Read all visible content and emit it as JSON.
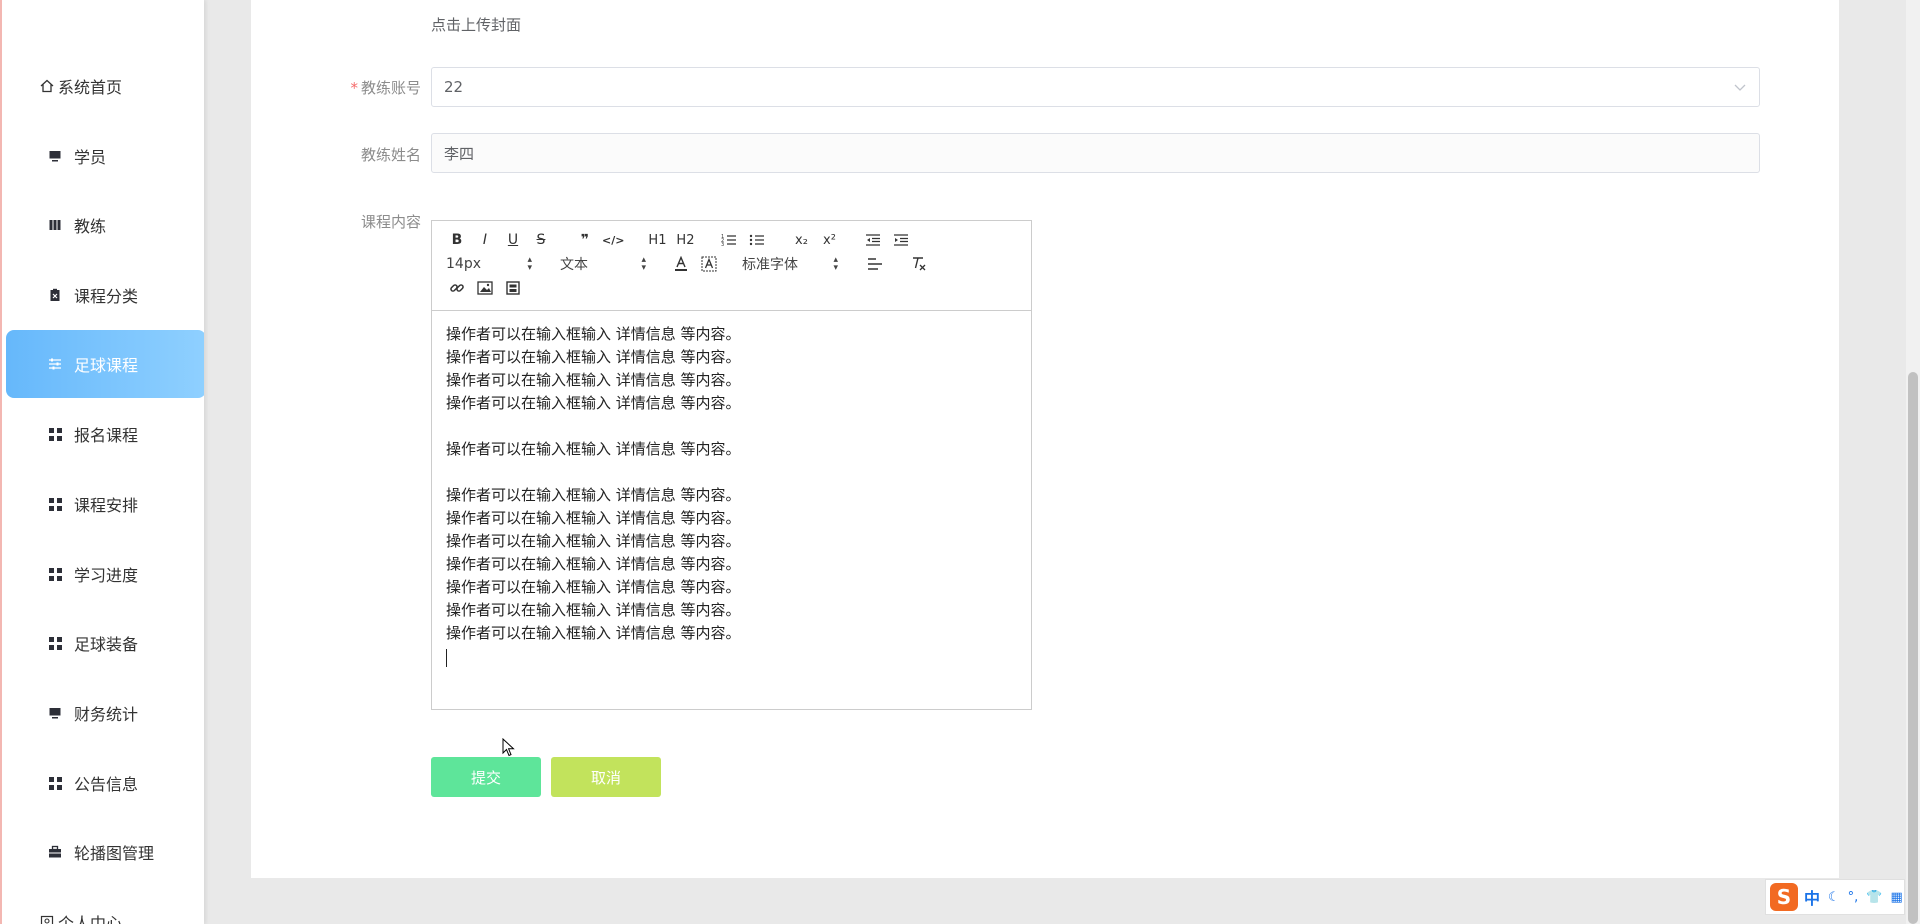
{
  "sidebar": {
    "items": [
      {
        "label": "系统首页",
        "icon": "home-icon"
      },
      {
        "label": "学员",
        "icon": "monitor-icon"
      },
      {
        "label": "教练",
        "icon": "book-icon"
      },
      {
        "label": "课程分类",
        "icon": "clipboard-icon"
      },
      {
        "label": "足球课程",
        "icon": "sliders-icon",
        "active": true
      },
      {
        "label": "报名课程",
        "icon": "grid-icon"
      },
      {
        "label": "课程安排",
        "icon": "grid-icon"
      },
      {
        "label": "学习进度",
        "icon": "grid-icon"
      },
      {
        "label": "足球装备",
        "icon": "grid-icon"
      },
      {
        "label": "财务统计",
        "icon": "monitor-icon"
      },
      {
        "label": "公告信息",
        "icon": "grid-icon"
      },
      {
        "label": "轮播图管理",
        "icon": "briefcase-icon"
      },
      {
        "label": "个人中心",
        "icon": "person-icon"
      }
    ]
  },
  "form": {
    "cover_upload_text": "点击上传封面",
    "coach_account_label": "教练账号",
    "coach_account_value": "22",
    "coach_name_label": "教练姓名",
    "coach_name_value": "李四",
    "course_content_label": "课程内容"
  },
  "editor": {
    "toolbar": {
      "bold": "B",
      "italic": "I",
      "underline": "U",
      "strike": "S",
      "quote": "❞",
      "code": "</>",
      "h1": "H1",
      "h2": "H2",
      "subscript": "x₂",
      "superscript": "x²",
      "font_size": "14px",
      "header_select": "文本",
      "font_family": "标准字体"
    },
    "lines": {
      "l1": "操作者可以在输入框输入  详情信息  等内容。",
      "l2": "操作者可以在输入框输入  详情信息  等内容。",
      "l3": "操作者可以在输入框输入  详情信息  等内容。",
      "l4": "操作者可以在输入框输入  详情信息  等内容。",
      "l5": "操作者可以在输入框输入  详情信息  等内容。",
      "l6": "操作者可以在输入框输入  详情信息  等内容。",
      "l7": "操作者可以在输入框输入  详情信息  等内容。",
      "l8": "操作者可以在输入框输入  详情信息  等内容。",
      "l9": "操作者可以在输入框输入  详情信息  等内容。",
      "l10": "操作者可以在输入框输入  详情信息  等内容。",
      "l11": "操作者可以在输入框输入  详情信息  等内容。",
      "l12": "操作者可以在输入框输入  详情信息  等内容。"
    }
  },
  "buttons": {
    "submit": "提交",
    "cancel": "取消"
  },
  "ime": {
    "logo": "S",
    "mode": "中"
  }
}
